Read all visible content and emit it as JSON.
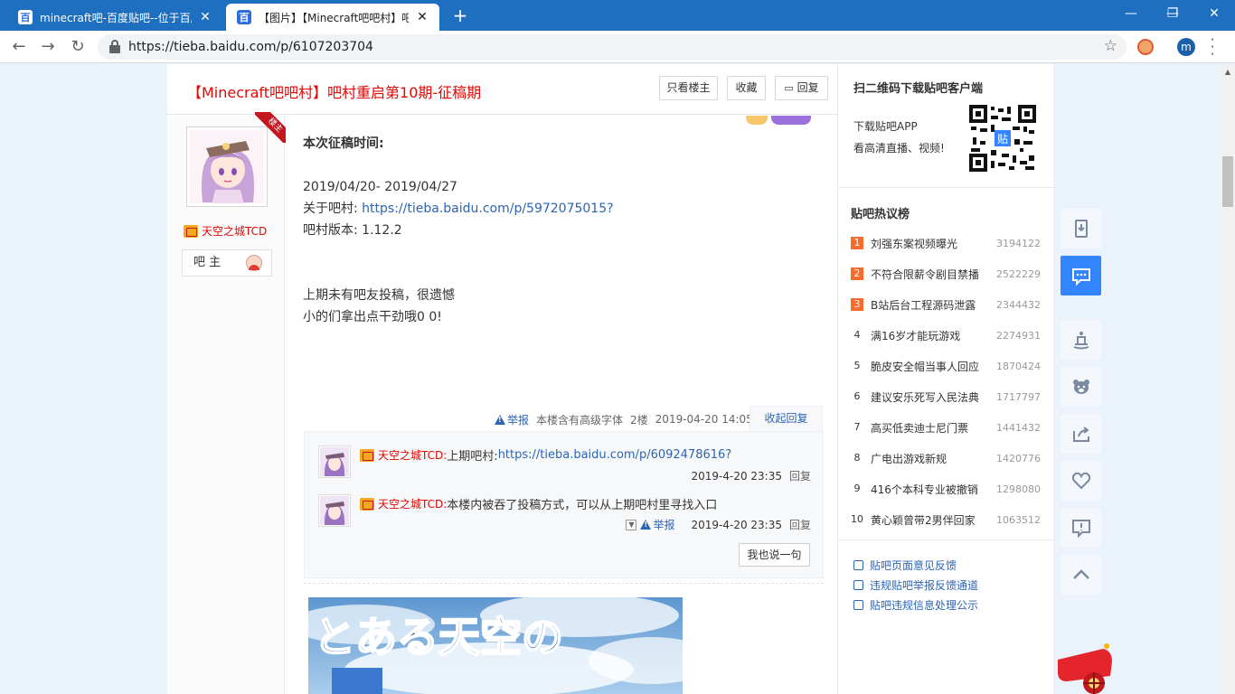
{
  "browser": {
    "tabs": [
      {
        "title": "minecraft吧-百度贴吧--位于百度",
        "favicon": "百",
        "active": false
      },
      {
        "title": "【图片】【Minecraft吧吧村】吧",
        "favicon": "百",
        "active": true
      }
    ],
    "new_tab": "+",
    "window_controls": {
      "minimize": "—",
      "maximize": "❐",
      "close": "✕"
    },
    "url": "https://tieba.baidu.com/p/6107203704",
    "profile_initial": "m"
  },
  "thread": {
    "title": "【Minecraft吧吧村】吧村重启第10期-征稿期",
    "buttons": {
      "only_op": "只看楼主",
      "favorite": "收藏",
      "reply": "回复"
    }
  },
  "author": {
    "name": "天空之城TCD",
    "role": "吧 主",
    "ribbon": "楼主"
  },
  "post": {
    "lines": [
      {
        "text": "本次征稿时间:",
        "bold": true
      },
      {
        "text": "2019/04/20- 2019/04/27"
      },
      {
        "label": "关于吧村: ",
        "link": "https://tieba.baidu.com/p/5972075015?"
      },
      {
        "text": "吧村版本: 1.12.2"
      },
      {
        "text": "上期未有吧友投稿，很遗憾"
      },
      {
        "text": "小的们拿出点干劲哦0 0!"
      }
    ],
    "meta": {
      "report": "举报",
      "font_note": "本楼含有高级字体",
      "floor": "2楼",
      "time": "2019-04-20 14:05",
      "collapse": "收起回复"
    }
  },
  "comments": [
    {
      "user": "天空之城TCD:",
      "text": " 上期吧村: ",
      "link": "https://tieba.baidu.com/p/6092478616?",
      "time": "2019-4-20 23:35",
      "reply": "回复"
    },
    {
      "user": "天空之城TCD:",
      "text": " 本楼内被吞了投稿方式，可以从上期吧村里寻找入口",
      "link": "",
      "report": "举报",
      "time": "2019-4-20 23:35",
      "reply": "回复"
    }
  ],
  "say_button": "我也说一句",
  "image": {
    "title_text": "とある天空の"
  },
  "sidebar": {
    "qr_title": "扫二维码下载贴吧客户端",
    "qr_line1": "下载贴吧APP",
    "qr_line2": "看高清直播、视频!",
    "qr_center": "贴",
    "hot_title": "贴吧热议榜",
    "hot_list": [
      {
        "rank": "1",
        "name": "刘强东案视频曝光",
        "value": "3194122"
      },
      {
        "rank": "2",
        "name": "不符合限薪令剧目禁播",
        "value": "2522229"
      },
      {
        "rank": "3",
        "name": "B站后台工程源码泄露",
        "value": "2344432"
      },
      {
        "rank": "4",
        "name": "满16岁才能玩游戏",
        "value": "2274931"
      },
      {
        "rank": "5",
        "name": "脆皮安全帽当事人回应",
        "value": "1870424"
      },
      {
        "rank": "6",
        "name": "建议安乐死写入民法典",
        "value": "1717797"
      },
      {
        "rank": "7",
        "name": "高买低卖迪士尼门票",
        "value": "1441432"
      },
      {
        "rank": "8",
        "name": "广电出游戏新规",
        "value": "1420776"
      },
      {
        "rank": "9",
        "name": "416个本科专业被撤销",
        "value": "1298080"
      },
      {
        "rank": "10",
        "name": "黄心颖曾带2男伴回家",
        "value": "1063512"
      }
    ],
    "feedback": [
      "贴吧页面意见反馈",
      "违规贴吧举报反馈通道",
      "贴吧违规信息处理公示"
    ]
  },
  "tools": [
    "download-icon",
    "chat-icon",
    "magic-hat-icon",
    "bear-icon",
    "share-icon",
    "heart-icon",
    "report-icon",
    "back-to-top-icon"
  ],
  "colors": {
    "accent": "#3385ff",
    "title_red": "#e10602",
    "link_blue": "#2d64b3",
    "tab_blue": "#1f6fc0",
    "rank_orange": "#f56c2e"
  }
}
